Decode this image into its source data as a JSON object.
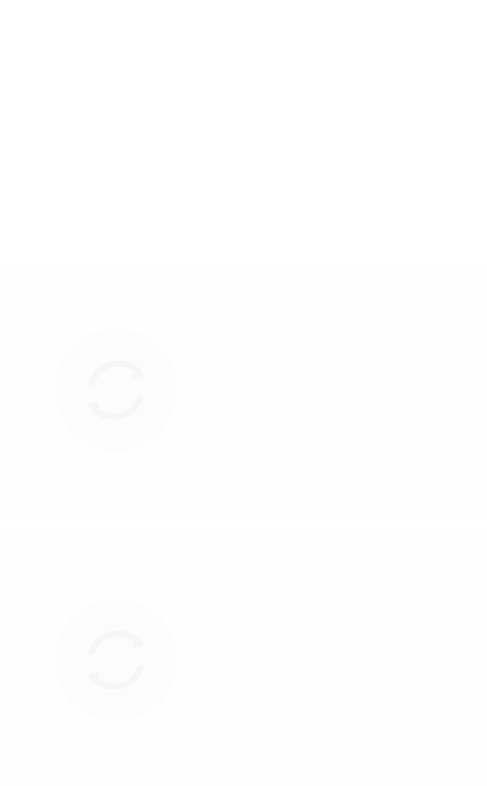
{
  "screen": {
    "background_color": "#ffffff",
    "card_color": "#fefefe"
  },
  "cards": [
    {
      "icon": "refresh-icon",
      "title": "",
      "subtitle": ""
    },
    {
      "icon": "refresh-icon",
      "title": "",
      "subtitle": ""
    }
  ]
}
